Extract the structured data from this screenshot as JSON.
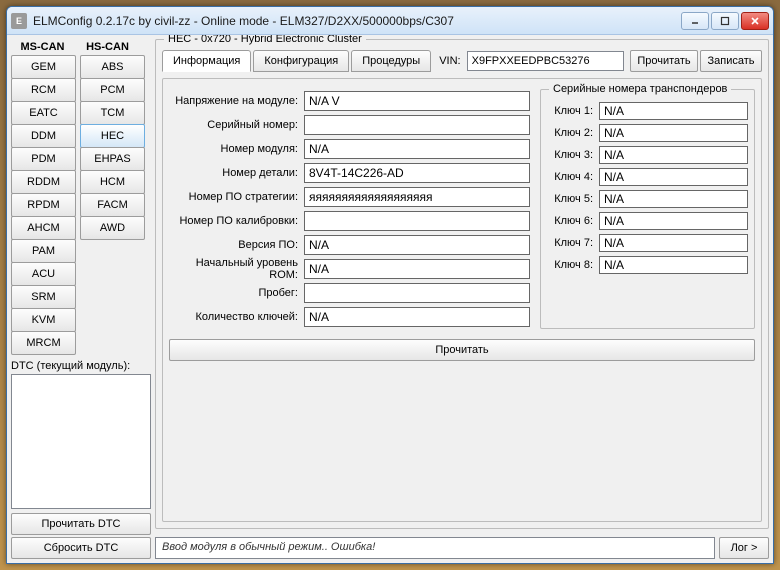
{
  "window": {
    "title": "ELMConfig 0.2.17c by civil-zz - Online mode - ELM327/D2XX/500000bps/C307",
    "icon_text": "E"
  },
  "columns": {
    "ms_can_header": "MS-CAN",
    "hs_can_header": "HS-CAN",
    "ms_can": [
      "GEM",
      "RCM",
      "EATC",
      "DDM",
      "PDM",
      "RDDM",
      "RPDM",
      "AHCM",
      "PAM",
      "ACU",
      "SRM",
      "KVM",
      "MRCM"
    ],
    "hs_can": [
      "ABS",
      "PCM",
      "TCM",
      "HEC",
      "EHPAS",
      "HCM",
      "FACM",
      "AWD"
    ],
    "selected": "HEC"
  },
  "dtc": {
    "label": "DTC (текущий модуль):",
    "read_btn": "Прочитать DTC",
    "clear_btn": "Сбросить DTC"
  },
  "group": {
    "title": "HEC - 0x720 - Hybrid Electronic Cluster",
    "tabs": {
      "info": "Информация",
      "config": "Конфигурация",
      "proc": "Процедуры"
    },
    "vin_label": "VIN:",
    "vin_value": "X9FPXXEEDPBC53276",
    "read_btn": "Прочитать",
    "write_btn": "Записать"
  },
  "info": {
    "rows": [
      {
        "label": "Напряжение на модуле:",
        "value": "N/A V"
      },
      {
        "label": "Серийный номер:",
        "value": ""
      },
      {
        "label": "Номер модуля:",
        "value": "N/A"
      },
      {
        "label": "Номер детали:",
        "value": "8V4T-14C226-AD"
      },
      {
        "label": "Номер ПО стратегии:",
        "value": "яяяяяяяяяяяяяяяяяяя"
      },
      {
        "label": "Номер ПО калибровки:",
        "value": ""
      },
      {
        "label": "Версия ПО:",
        "value": "N/A"
      },
      {
        "label": "Начальный уровень ROM:",
        "value": "N/A"
      },
      {
        "label": "Пробег:",
        "value": ""
      },
      {
        "label": "Количество ключей:",
        "value": "N/A"
      }
    ],
    "read_btn": "Прочитать"
  },
  "keys": {
    "title": "Серийные номера транспондеров",
    "rows": [
      {
        "label": "Ключ 1:",
        "value": "N/A"
      },
      {
        "label": "Ключ 2:",
        "value": "N/A"
      },
      {
        "label": "Ключ 3:",
        "value": "N/A"
      },
      {
        "label": "Ключ 4:",
        "value": "N/A"
      },
      {
        "label": "Ключ 5:",
        "value": "N/A"
      },
      {
        "label": "Ключ 6:",
        "value": "N/A"
      },
      {
        "label": "Ключ 7:",
        "value": "N/A"
      },
      {
        "label": "Ключ 8:",
        "value": "N/A"
      }
    ]
  },
  "status": {
    "message": "Ввод модуля в обычный режим.. Ошибка!",
    "log_btn": "Лог >"
  }
}
